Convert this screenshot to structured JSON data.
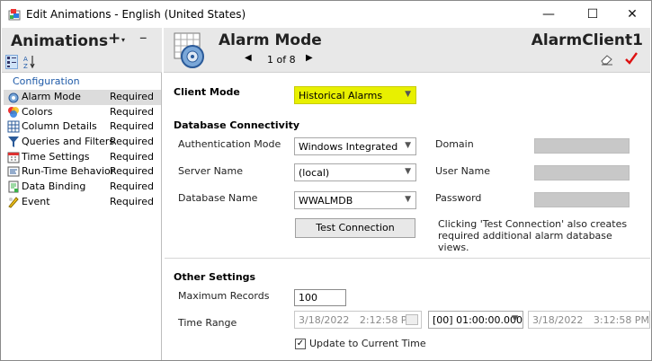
{
  "window": {
    "title": "Edit Animations - English (United States)",
    "controls": {
      "minimize": "—",
      "maximize": "☐",
      "close": "✕"
    }
  },
  "left": {
    "title": "Animations",
    "add_label": "+",
    "add_caret": "▾",
    "remove_label": "–",
    "category_header": "Configuration",
    "items": [
      {
        "name": "Alarm Mode",
        "status": "Required",
        "icon": "alarm-mode-icon"
      },
      {
        "name": "Colors",
        "status": "Required",
        "icon": "colors-icon"
      },
      {
        "name": "Column Details",
        "status": "Required",
        "icon": "column-details-icon"
      },
      {
        "name": "Queries and Filters",
        "status": "Required",
        "icon": "filter-icon"
      },
      {
        "name": "Time Settings",
        "status": "Required",
        "icon": "time-settings-icon"
      },
      {
        "name": "Run-Time Behavior",
        "status": "Required",
        "icon": "runtime-behavior-icon"
      },
      {
        "name": "Data Binding",
        "status": "Required",
        "icon": "data-binding-icon"
      },
      {
        "name": "Event",
        "status": "Required",
        "icon": "event-icon"
      }
    ],
    "selected_index": 0
  },
  "header": {
    "title": "Alarm Mode",
    "nav_text": "1 of 8",
    "client_name": "AlarmClient1"
  },
  "client_mode": {
    "label": "Client Mode",
    "value": "Historical Alarms",
    "highlight_color": "#e8f000"
  },
  "db": {
    "section": "Database Connectivity",
    "auth_label": "Authentication Mode",
    "auth_value": "Windows Integrated",
    "server_label": "Server Name",
    "server_value": "(local)",
    "dbname_label": "Database Name",
    "dbname_value": "WWALMDB",
    "domain_label": "Domain",
    "username_label": "User Name",
    "password_label": "Password",
    "test_button": "Test Connection",
    "note": "Clicking 'Test Connection' also creates required additional alarm database views."
  },
  "other": {
    "section": "Other Settings",
    "max_records_label": "Maximum Records",
    "max_records_value": "100",
    "time_range_label": "Time Range",
    "start_date": "3/18/2022",
    "start_time": "2:12:58 PM",
    "duration": "[00] 01:00:00.000",
    "end_date": "3/18/2022",
    "end_time": "3:12:58 PM",
    "update_label": "Update to Current Time",
    "update_checked": true
  }
}
